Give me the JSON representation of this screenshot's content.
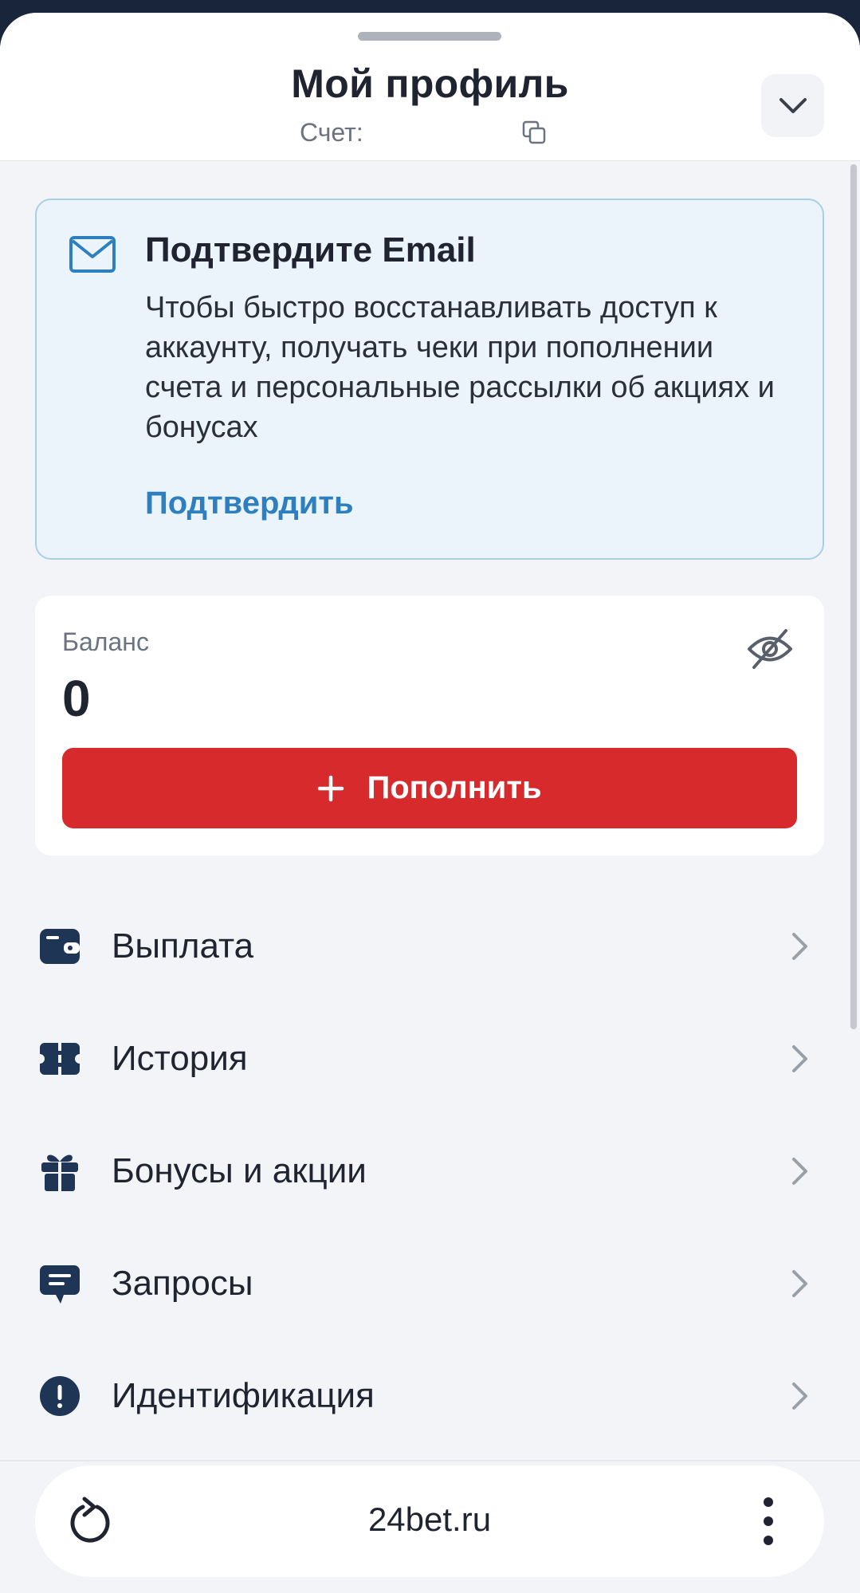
{
  "header": {
    "title": "Мой профиль",
    "account_label": "Счет:"
  },
  "email_card": {
    "title": "Подтвердите Email",
    "text": "Чтобы быстро восстанавливать доступ к аккаунту, получать чеки при пополнении счета и персональные рассылки об акциях и бонусах",
    "link": "Подтвердить"
  },
  "balance": {
    "label": "Баланс",
    "value": "0",
    "topup_label": "Пополнить"
  },
  "menu": {
    "items": [
      {
        "label": "Выплата",
        "icon": "wallet-icon"
      },
      {
        "label": "История",
        "icon": "ticket-icon"
      },
      {
        "label": "Бонусы и акции",
        "icon": "gift-icon"
      },
      {
        "label": "Запросы",
        "icon": "chat-icon"
      },
      {
        "label": "Идентификация",
        "icon": "alert-icon"
      }
    ]
  },
  "browser": {
    "url": "24bet.ru"
  },
  "colors": {
    "accent_red": "#d72a2d",
    "link_blue": "#2d7fbf",
    "icon_navy": "#1e3555"
  }
}
